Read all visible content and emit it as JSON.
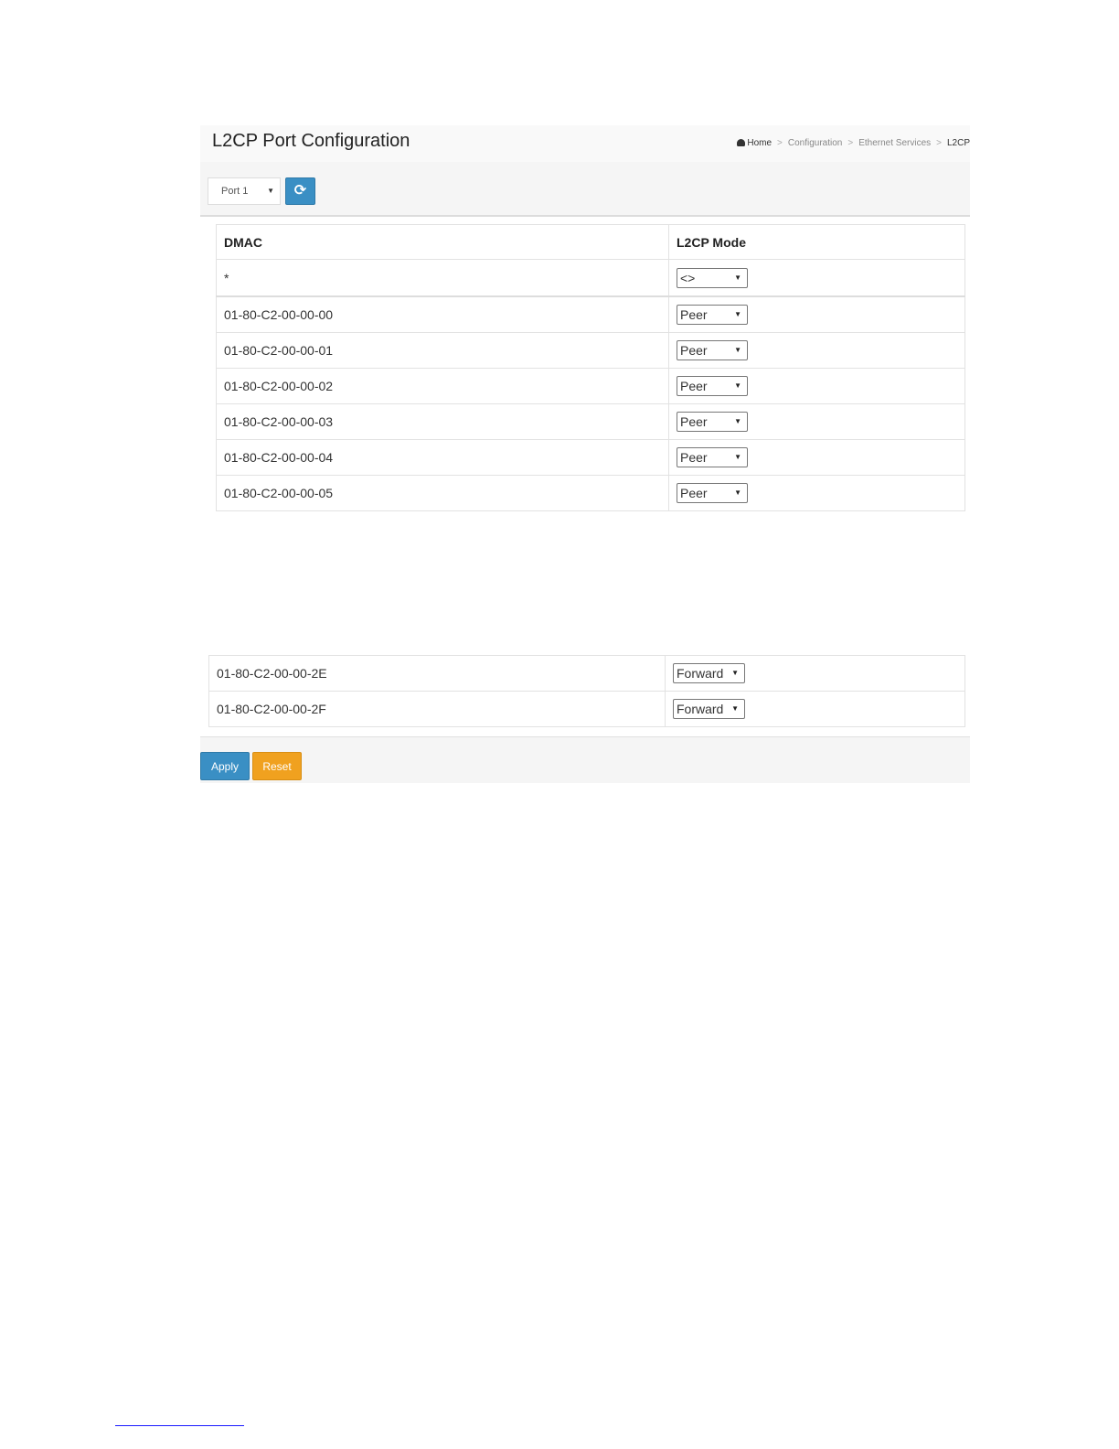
{
  "page": {
    "title": "L2CP Port Configuration",
    "breadcrumb": [
      "Home",
      "Configuration",
      "Ethernet Services",
      "L2CP"
    ]
  },
  "toolbar": {
    "port_select": "Port 1",
    "refresh_icon": "refresh-icon"
  },
  "table": {
    "headers": [
      "DMAC",
      "L2CP Mode"
    ],
    "star_row": {
      "dmac": "*",
      "mode": "<>"
    },
    "rows_top": [
      {
        "dmac": "01-80-C2-00-00-00",
        "mode": "Peer"
      },
      {
        "dmac": "01-80-C2-00-00-01",
        "mode": "Peer"
      },
      {
        "dmac": "01-80-C2-00-00-02",
        "mode": "Peer"
      },
      {
        "dmac": "01-80-C2-00-00-03",
        "mode": "Peer"
      },
      {
        "dmac": "01-80-C2-00-00-04",
        "mode": "Peer"
      },
      {
        "dmac": "01-80-C2-00-00-05",
        "mode": "Peer"
      }
    ],
    "rows_bottom": [
      {
        "dmac": "01-80-C2-00-00-2E",
        "mode": "Forward"
      },
      {
        "dmac": "01-80-C2-00-00-2F",
        "mode": "Forward"
      }
    ]
  },
  "buttons": {
    "apply": "Apply",
    "reset": "Reset"
  },
  "colors": {
    "primary": "#3a8fc4",
    "warning": "#f0a11f"
  }
}
